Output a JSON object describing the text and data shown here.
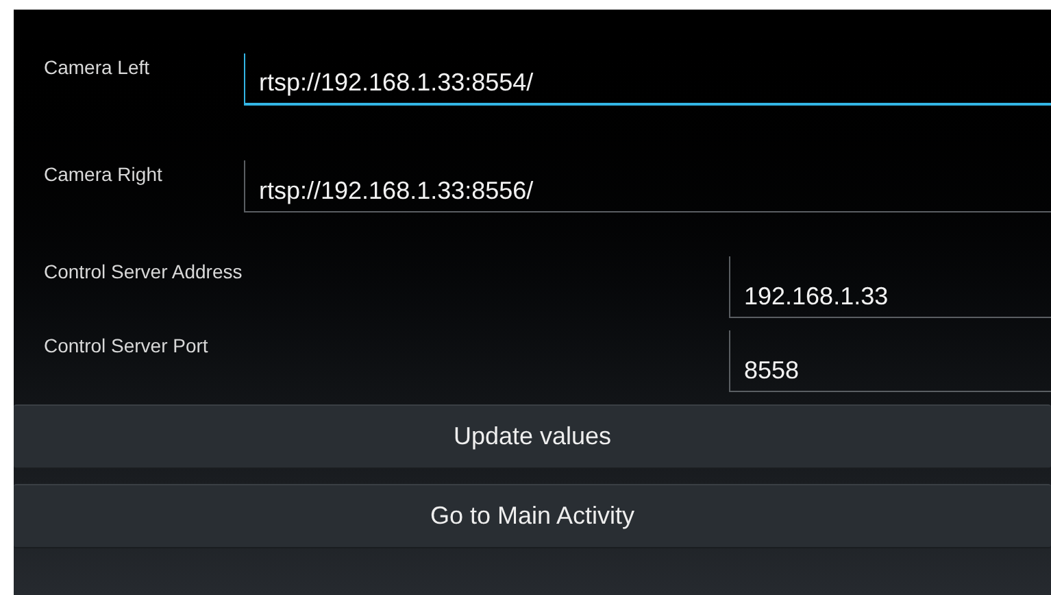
{
  "camera_fields": [
    {
      "label": "Camera Left",
      "value": "rtsp://192.168.1.33:8554/",
      "focused": true
    },
    {
      "label": "Camera Right",
      "value": "rtsp://192.168.1.33:8556/",
      "focused": false
    }
  ],
  "server_fields": [
    {
      "label": "Control Server Address",
      "value": "192.168.1.33",
      "focused": false
    },
    {
      "label": "Control Server Port",
      "value": "8558",
      "focused": false
    }
  ],
  "buttons": [
    "Update values",
    "Go to Main Activity"
  ]
}
